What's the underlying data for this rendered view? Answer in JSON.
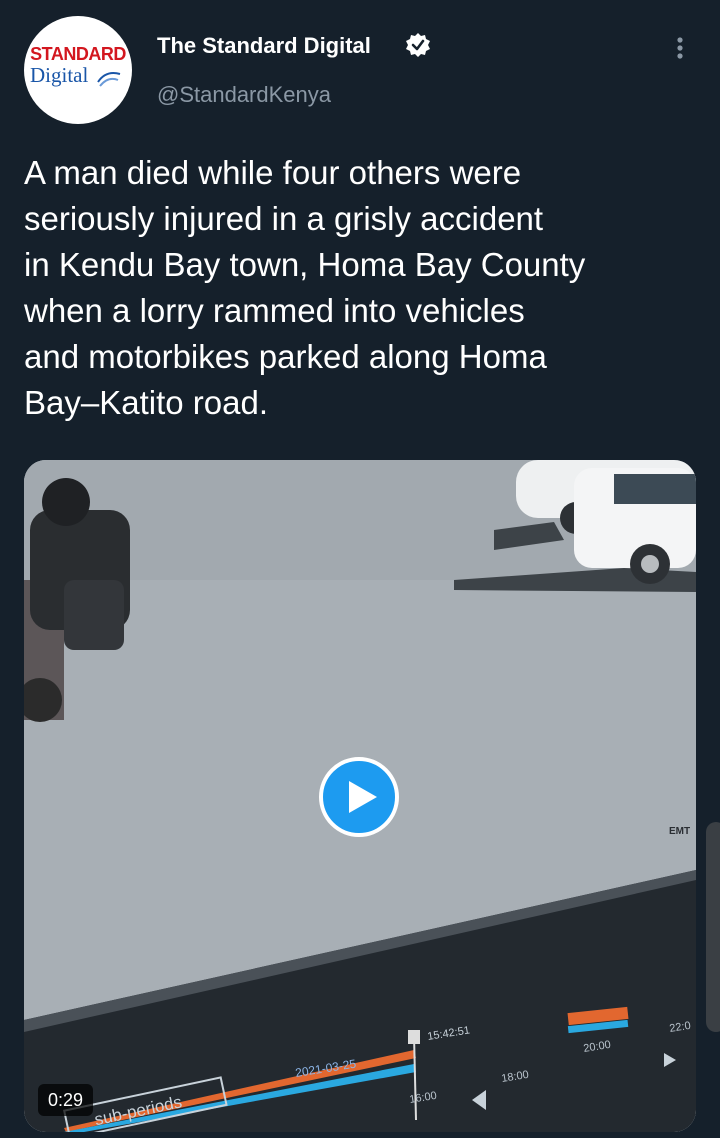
{
  "account": {
    "display_name": "The Standard Digital",
    "handle": "@StandardKenya",
    "logo": {
      "top": "STANDARD",
      "bottom": "Digital"
    }
  },
  "tweet": {
    "text": "A man died while four others were\nseriously injured in a grisly accident\nin Kendu Bay town, Homa Bay County\nwhen a lorry rammed into vehicles\nand motorbikes parked along Homa\nBay–Katito road."
  },
  "video": {
    "duration": "0:29",
    "overlay_date": "2021-03-25",
    "overlay_time": "15:42:51",
    "overlay_ticks": [
      "16:00",
      "18:00",
      "20:00",
      "22:0"
    ],
    "overlay_label": "sub-periods",
    "overlay_wall_text": "EMT"
  },
  "colors": {
    "background": "#15202b",
    "accent": "#1d9bf0",
    "secondary_text": "#8b98a5"
  },
  "icons": {
    "verified": "verified-badge-icon",
    "more": "more-vertical-icon",
    "play": "play-icon"
  }
}
